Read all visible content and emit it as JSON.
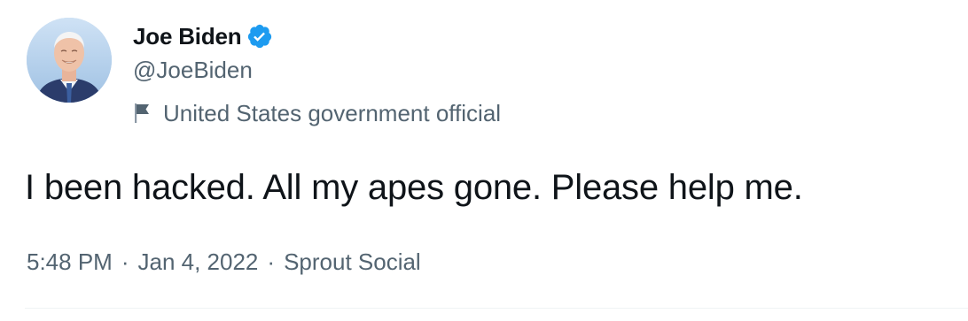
{
  "author": {
    "display_name": "Joe Biden",
    "handle": "@JoeBiden",
    "verified": true,
    "avatar_icon": "profile-photo",
    "label": "United States government official",
    "label_icon": "flag-icon"
  },
  "tweet": {
    "text": "I been hacked. All my apes gone. Please help me.",
    "time": "5:48 PM",
    "separator": "·",
    "date": "Jan 4, 2022",
    "source": "Sprout Social"
  },
  "colors": {
    "primary_text": "#0f1419",
    "secondary_text": "#536471",
    "verified_blue": "#1d9bf0",
    "divider": "#eff3f4"
  }
}
